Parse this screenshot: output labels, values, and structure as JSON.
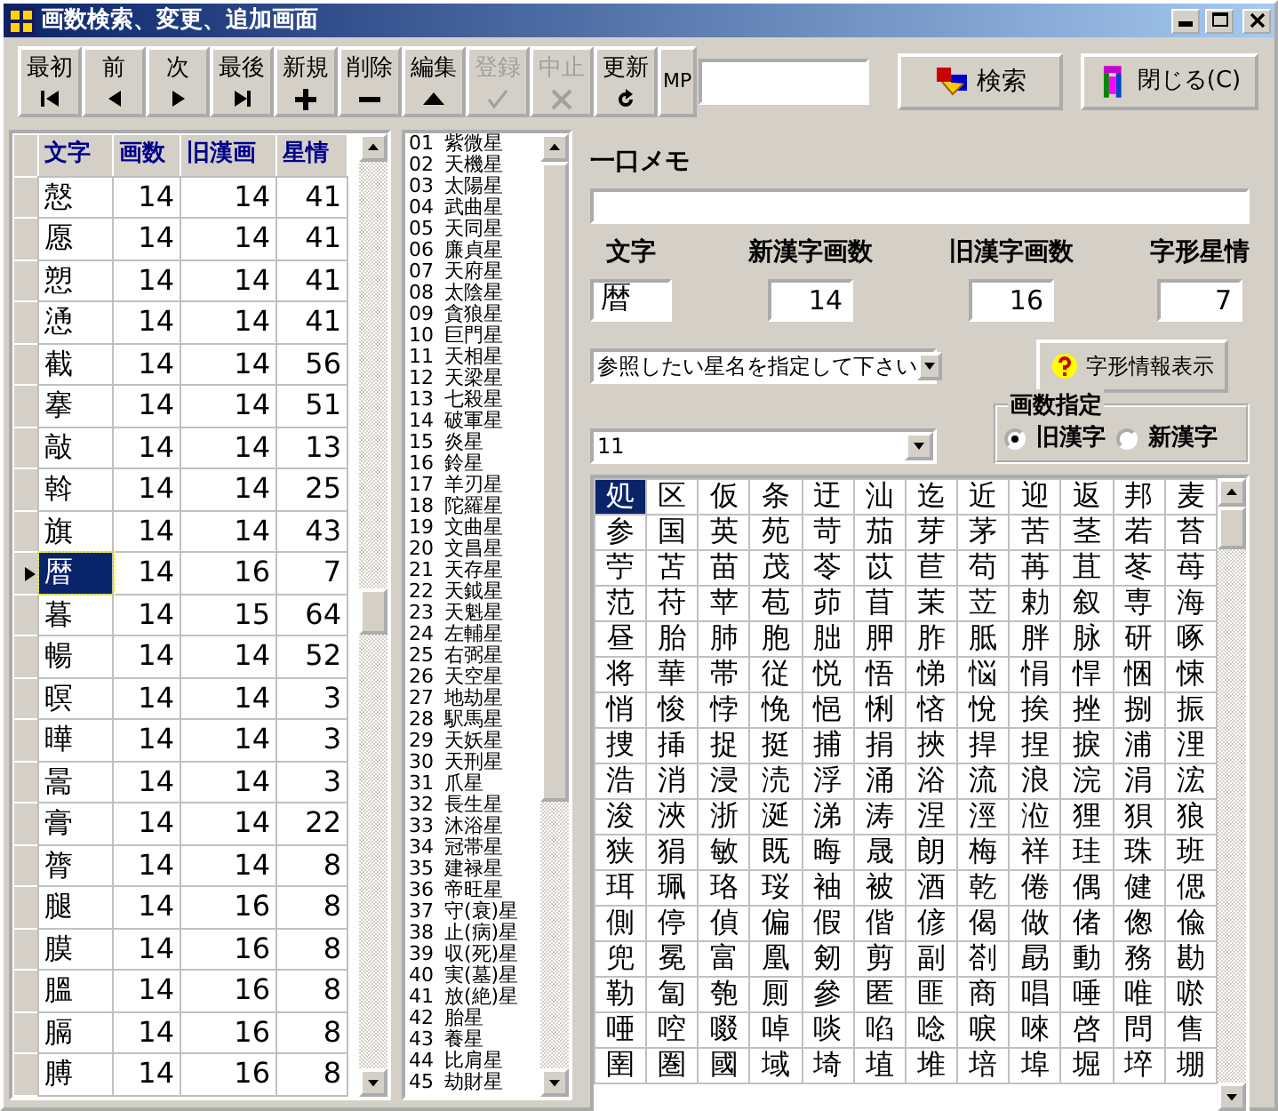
{
  "window": {
    "title": "画数検索、変更、追加画面"
  },
  "toolbar": {
    "buttons": [
      {
        "label": "最初",
        "kind": "first",
        "disabled": false
      },
      {
        "label": "前",
        "kind": "prev",
        "disabled": false
      },
      {
        "label": "次",
        "kind": "next",
        "disabled": false
      },
      {
        "label": "最後",
        "kind": "last",
        "disabled": false
      },
      {
        "label": "新規",
        "kind": "add",
        "disabled": false
      },
      {
        "label": "削除",
        "kind": "remove",
        "disabled": false
      },
      {
        "label": "編集",
        "kind": "edit",
        "disabled": false
      },
      {
        "label": "登録",
        "kind": "save",
        "disabled": true
      },
      {
        "label": "中止",
        "kind": "cancel",
        "disabled": true
      },
      {
        "label": "更新",
        "kind": "refresh",
        "disabled": false
      }
    ],
    "mp_label": "MP",
    "search_button": "検索",
    "close_button": "閉じる(C)"
  },
  "kanji_table": {
    "columns": [
      "文字",
      "画数",
      "旧漢画",
      "星情"
    ],
    "rows": [
      {
        "cells": [
          "慤",
          "14",
          "14",
          "41"
        ],
        "selected": false
      },
      {
        "cells": [
          "愿",
          "14",
          "14",
          "41"
        ],
        "selected": false
      },
      {
        "cells": [
          "愬",
          "14",
          "14",
          "41"
        ],
        "selected": false
      },
      {
        "cells": [
          "慂",
          "14",
          "14",
          "41"
        ],
        "selected": false
      },
      {
        "cells": [
          "截",
          "14",
          "14",
          "56"
        ],
        "selected": false
      },
      {
        "cells": [
          "搴",
          "14",
          "14",
          "51"
        ],
        "selected": false
      },
      {
        "cells": [
          "敲",
          "14",
          "14",
          "13"
        ],
        "selected": false
      },
      {
        "cells": [
          "斡",
          "14",
          "14",
          "25"
        ],
        "selected": false
      },
      {
        "cells": [
          "旗",
          "14",
          "14",
          "43"
        ],
        "selected": false
      },
      {
        "cells": [
          "暦",
          "14",
          "16",
          "7"
        ],
        "selected": true
      },
      {
        "cells": [
          "暮",
          "14",
          "15",
          "64"
        ],
        "selected": false
      },
      {
        "cells": [
          "暢",
          "14",
          "14",
          "52"
        ],
        "selected": false
      },
      {
        "cells": [
          "暝",
          "14",
          "14",
          "3"
        ],
        "selected": false
      },
      {
        "cells": [
          "曄",
          "14",
          "14",
          "3"
        ],
        "selected": false
      },
      {
        "cells": [
          "暠",
          "14",
          "14",
          "3"
        ],
        "selected": false
      },
      {
        "cells": [
          "膏",
          "14",
          "14",
          "22"
        ],
        "selected": false
      },
      {
        "cells": [
          "膂",
          "14",
          "14",
          "8"
        ],
        "selected": false
      },
      {
        "cells": [
          "腿",
          "14",
          "16",
          "8"
        ],
        "selected": false
      },
      {
        "cells": [
          "膜",
          "14",
          "16",
          "8"
        ],
        "selected": false
      },
      {
        "cells": [
          "膃",
          "14",
          "16",
          "8"
        ],
        "selected": false
      },
      {
        "cells": [
          "膈",
          "14",
          "16",
          "8"
        ],
        "selected": false
      },
      {
        "cells": [
          "膊",
          "14",
          "16",
          "8"
        ],
        "selected": false
      }
    ]
  },
  "star_list": [
    {
      "number": "01",
      "name": "紫微星"
    },
    {
      "number": "02",
      "name": "天機星"
    },
    {
      "number": "03",
      "name": "太陽星"
    },
    {
      "number": "04",
      "name": "武曲星"
    },
    {
      "number": "05",
      "name": "天同星"
    },
    {
      "number": "06",
      "name": "廉貞星"
    },
    {
      "number": "07",
      "name": "天府星"
    },
    {
      "number": "08",
      "name": "太陰星"
    },
    {
      "number": "09",
      "name": "貪狼星"
    },
    {
      "number": "10",
      "name": "巨門星"
    },
    {
      "number": "11",
      "name": "天相星"
    },
    {
      "number": "12",
      "name": "天梁星"
    },
    {
      "number": "13",
      "name": "七殺星"
    },
    {
      "number": "14",
      "name": "破軍星"
    },
    {
      "number": "15",
      "name": "炎星"
    },
    {
      "number": "16",
      "name": "鈴星"
    },
    {
      "number": "17",
      "name": "羊刃星"
    },
    {
      "number": "18",
      "name": "陀羅星"
    },
    {
      "number": "19",
      "name": "文曲星"
    },
    {
      "number": "20",
      "name": "文昌星"
    },
    {
      "number": "21",
      "name": "天存星"
    },
    {
      "number": "22",
      "name": "天鉞星"
    },
    {
      "number": "23",
      "name": "天魁星"
    },
    {
      "number": "24",
      "name": "左輔星"
    },
    {
      "number": "25",
      "name": "右弼星"
    },
    {
      "number": "26",
      "name": "天空星"
    },
    {
      "number": "27",
      "name": "地劫星"
    },
    {
      "number": "28",
      "name": "駅馬星"
    },
    {
      "number": "29",
      "name": "天妖星"
    },
    {
      "number": "30",
      "name": "天刑星"
    },
    {
      "number": "31",
      "name": "爪星"
    },
    {
      "number": "32",
      "name": "長生星"
    },
    {
      "number": "33",
      "name": "沐浴星"
    },
    {
      "number": "34",
      "name": "冠帯星"
    },
    {
      "number": "35",
      "name": "建禄星"
    },
    {
      "number": "36",
      "name": "帝旺星"
    },
    {
      "number": "37",
      "name": "守(衰)星"
    },
    {
      "number": "38",
      "name": "止(病)星"
    },
    {
      "number": "39",
      "name": "収(死)星"
    },
    {
      "number": "40",
      "name": "実(墓)星"
    },
    {
      "number": "41",
      "name": "放(絶)星"
    },
    {
      "number": "42",
      "name": "胎星"
    },
    {
      "number": "43",
      "name": "養星"
    },
    {
      "number": "44",
      "name": "比肩星"
    },
    {
      "number": "45",
      "name": "劫財星"
    }
  ],
  "memo": {
    "label": "一口メモ"
  },
  "fields": [
    {
      "label": "文字",
      "value": "暦",
      "kind": "text"
    },
    {
      "label": "新漢字画数",
      "value": "14",
      "kind": "number"
    },
    {
      "label": "旧漢字画数",
      "value": "16",
      "kind": "number"
    },
    {
      "label": "字形星情",
      "value": "7",
      "kind": "number"
    }
  ],
  "star_select": {
    "value": "参照したい星名を指定して下さい"
  },
  "info_button": "字形情報表示",
  "stroke_select": {
    "value": "11"
  },
  "stroke_mode": {
    "label": "画数指定",
    "options": [
      {
        "label": "旧漢字",
        "selected": true
      },
      {
        "label": "新漢字",
        "selected": false
      }
    ]
  },
  "char_grid": [
    {
      "chars": [
        "処",
        "区",
        "仮",
        "条",
        "迂",
        "汕",
        "迄",
        "近",
        "迎",
        "返",
        "邦",
        "麦"
      ],
      "selected": [
        true,
        false,
        false,
        false,
        false,
        false,
        false,
        false,
        false,
        false,
        false,
        false
      ]
    },
    {
      "chars": [
        "参",
        "国",
        "英",
        "苑",
        "苛",
        "茄",
        "芽",
        "茅",
        "苦",
        "茎",
        "若",
        "苔"
      ],
      "selected": [
        false,
        false,
        false,
        false,
        false,
        false,
        false,
        false,
        false,
        false,
        false,
        false
      ]
    },
    {
      "chars": [
        "苧",
        "苫",
        "苗",
        "茂",
        "苓",
        "苡",
        "苣",
        "苟",
        "苒",
        "苴",
        "苳",
        "苺"
      ],
      "selected": [
        false,
        false,
        false,
        false,
        false,
        false,
        false,
        false,
        false,
        false,
        false,
        false
      ]
    },
    {
      "chars": [
        "范",
        "苻",
        "苹",
        "苞",
        "茆",
        "苜",
        "茉",
        "苙",
        "勅",
        "叙",
        "専",
        "海"
      ],
      "selected": [
        false,
        false,
        false,
        false,
        false,
        false,
        false,
        false,
        false,
        false,
        false,
        false
      ]
    },
    {
      "chars": [
        "昼",
        "胎",
        "肺",
        "胞",
        "胐",
        "胛",
        "胙",
        "胝",
        "胖",
        "脉",
        "研",
        "啄"
      ],
      "selected": [
        false,
        false,
        false,
        false,
        false,
        false,
        false,
        false,
        false,
        false,
        false,
        false
      ]
    },
    {
      "chars": [
        "将",
        "華",
        "帯",
        "従",
        "悦",
        "悟",
        "悌",
        "悩",
        "悁",
        "悍",
        "悃",
        "悚"
      ],
      "selected": [
        false,
        false,
        false,
        false,
        false,
        false,
        false,
        false,
        false,
        false,
        false,
        false
      ]
    },
    {
      "chars": [
        "悄",
        "悛",
        "悖",
        "悗",
        "悒",
        "悧",
        "悋",
        "悅",
        "挨",
        "挫",
        "捌",
        "振"
      ],
      "selected": [
        false,
        false,
        false,
        false,
        false,
        false,
        false,
        false,
        false,
        false,
        false,
        false
      ]
    },
    {
      "chars": [
        "捜",
        "挿",
        "捉",
        "挺",
        "捕",
        "捐",
        "挾",
        "捍",
        "捏",
        "捩",
        "浦",
        "浬"
      ],
      "selected": [
        false,
        false,
        false,
        false,
        false,
        false,
        false,
        false,
        false,
        false,
        false,
        false
      ]
    },
    {
      "chars": [
        "浩",
        "消",
        "浸",
        "涜",
        "浮",
        "涌",
        "浴",
        "流",
        "浪",
        "浣",
        "涓",
        "浤"
      ],
      "selected": [
        false,
        false,
        false,
        false,
        false,
        false,
        false,
        false,
        false,
        false,
        false,
        false
      ]
    },
    {
      "chars": [
        "浚",
        "浹",
        "浙",
        "涎",
        "涕",
        "涛",
        "涅",
        "涇",
        "涖",
        "狸",
        "狽",
        "狼"
      ],
      "selected": [
        false,
        false,
        false,
        false,
        false,
        false,
        false,
        false,
        false,
        false,
        false,
        false
      ]
    },
    {
      "chars": [
        "狭",
        "狷",
        "敏",
        "既",
        "晦",
        "晟",
        "朗",
        "梅",
        "祥",
        "珪",
        "珠",
        "班"
      ],
      "selected": [
        false,
        false,
        false,
        false,
        false,
        false,
        false,
        false,
        false,
        false,
        false,
        false
      ]
    },
    {
      "chars": [
        "珥",
        "珮",
        "珞",
        "珱",
        "袖",
        "被",
        "酒",
        "乾",
        "倦",
        "偶",
        "健",
        "偲"
      ],
      "selected": [
        false,
        false,
        false,
        false,
        false,
        false,
        false,
        false,
        false,
        false,
        false,
        false
      ]
    },
    {
      "chars": [
        "側",
        "停",
        "偵",
        "偏",
        "假",
        "偕",
        "偐",
        "偈",
        "做",
        "偖",
        "偬",
        "偸"
      ],
      "selected": [
        false,
        false,
        false,
        false,
        false,
        false,
        false,
        false,
        false,
        false,
        false,
        false
      ]
    },
    {
      "chars": [
        "兜",
        "冕",
        "富",
        "凰",
        "剱",
        "剪",
        "副",
        "剳",
        "勗",
        "動",
        "務",
        "勘"
      ],
      "selected": [
        false,
        false,
        false,
        false,
        false,
        false,
        false,
        false,
        false,
        false,
        false,
        false
      ]
    },
    {
      "chars": [
        "勒",
        "匐",
        "匏",
        "厠",
        "參",
        "匿",
        "匪",
        "商",
        "唱",
        "唾",
        "唯",
        "唹"
      ],
      "selected": [
        false,
        false,
        false,
        false,
        false,
        false,
        false,
        false,
        false,
        false,
        false,
        false
      ]
    },
    {
      "chars": [
        "唖",
        "啌",
        "啜",
        "啅",
        "啖",
        "啗",
        "唸",
        "唳",
        "唻",
        "啓",
        "問",
        "售"
      ],
      "selected": [
        false,
        false,
        false,
        false,
        false,
        false,
        false,
        false,
        false,
        false,
        false,
        false
      ]
    },
    {
      "chars": [
        "圉",
        "圏",
        "國",
        "域",
        "埼",
        "埴",
        "堆",
        "培",
        "埠",
        "堀",
        "埣",
        "堋"
      ],
      "selected": [
        false,
        false,
        false,
        false,
        false,
        false,
        false,
        false,
        false,
        false,
        false,
        false
      ]
    }
  ]
}
